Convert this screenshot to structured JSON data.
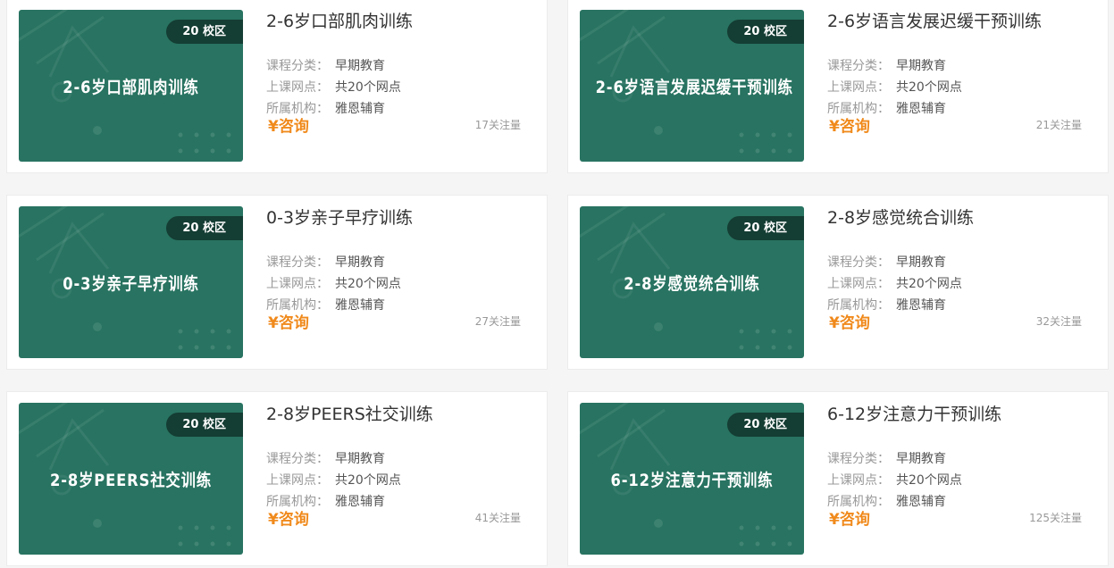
{
  "labels": {
    "category": "课程分类：",
    "venue": "上课网点：",
    "org": "所属机构："
  },
  "courses": [
    {
      "badge": "20 校区",
      "thumb_title": "2-6岁口部肌肉训练",
      "title": "2-6岁口部肌肉训练",
      "category": "早期教育",
      "venue": "共20个网点",
      "org": "雅恩辅育",
      "price": "¥咨询",
      "follow": "17关注量"
    },
    {
      "badge": "20 校区",
      "thumb_title": "2-6岁语言发展迟缓干预训练",
      "title": "2-6岁语言发展迟缓干预训练",
      "category": "早期教育",
      "venue": "共20个网点",
      "org": "雅恩辅育",
      "price": "¥咨询",
      "follow": "21关注量"
    },
    {
      "badge": "20 校区",
      "thumb_title": "0-3岁亲子早疗训练",
      "title": "0-3岁亲子早疗训练",
      "category": "早期教育",
      "venue": "共20个网点",
      "org": "雅恩辅育",
      "price": "¥咨询",
      "follow": "27关注量"
    },
    {
      "badge": "20 校区",
      "thumb_title": "2-8岁感觉统合训练",
      "title": "2-8岁感觉统合训练",
      "category": "早期教育",
      "venue": "共20个网点",
      "org": "雅恩辅育",
      "price": "¥咨询",
      "follow": "32关注量"
    },
    {
      "badge": "20 校区",
      "thumb_title": "2-8岁PEERS社交训练",
      "title": "2-8岁PEERS社交训练",
      "category": "早期教育",
      "venue": "共20个网点",
      "org": "雅恩辅育",
      "price": "¥咨询",
      "follow": "41关注量"
    },
    {
      "badge": "20 校区",
      "thumb_title": "6-12岁注意力干预训练",
      "title": "6-12岁注意力干预训练",
      "category": "早期教育",
      "venue": "共20个网点",
      "org": "雅恩辅育",
      "price": "¥咨询",
      "follow": "125关注量"
    }
  ],
  "colors": {
    "thumb_bg": "#287361",
    "badge_bg": "#143d33",
    "price": "#f08a1c"
  }
}
